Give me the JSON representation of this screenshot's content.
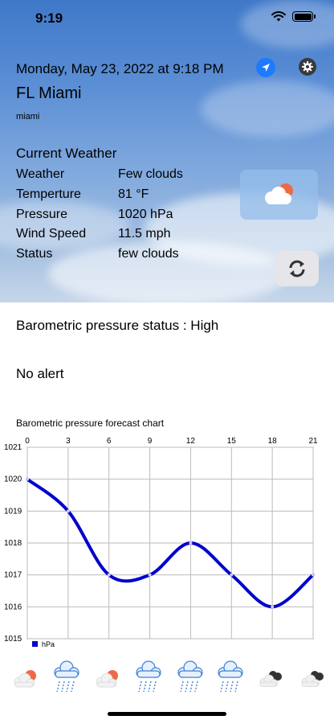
{
  "status_bar": {
    "time": "9:19"
  },
  "header": {
    "datetime": "Monday, May 23, 2022 at 9:18 PM",
    "city": "FL Miami",
    "city_sub": "miami"
  },
  "current": {
    "title": "Current Weather",
    "rows": [
      {
        "label": "Weather",
        "value": "Few clouds"
      },
      {
        "label": "Temperture",
        "value": "81 °F"
      },
      {
        "label": "Pressure",
        "value": "1020 hPa"
      },
      {
        "label": "Wind Speed",
        "value": "11.5 mph"
      },
      {
        "label": "Status",
        "value": "few clouds"
      }
    ],
    "icon": "few-clouds-icon"
  },
  "barometric_status": "Barometric pressure status : High",
  "alert": "No alert",
  "chart_title": "Barometric pressure forecast chart",
  "chart_data": {
    "type": "line",
    "x": [
      0,
      3,
      6,
      9,
      12,
      15,
      18,
      21
    ],
    "values": [
      1020,
      1019,
      1017,
      1017,
      1018,
      1017,
      1016,
      1017
    ],
    "x_ticks": [
      0,
      3,
      6,
      9,
      12,
      15,
      18,
      21
    ],
    "y_ticks": [
      1015,
      1016,
      1017,
      1018,
      1019,
      1020,
      1021
    ],
    "xlim": [
      0,
      21
    ],
    "ylim": [
      1015,
      1021
    ],
    "x_axis_position": "top",
    "grid": true,
    "legend": "bottom-left",
    "series_name": "hPa",
    "color": "#0000cc"
  },
  "forecast_icons": [
    "few-clouds-icon",
    "rain-icon",
    "few-clouds-icon",
    "rain-icon",
    "rain-icon",
    "rain-icon",
    "broken-clouds-icon",
    "broken-clouds-icon"
  ],
  "colors": {
    "accent": "#1e7bff",
    "series": "#0000cc"
  }
}
